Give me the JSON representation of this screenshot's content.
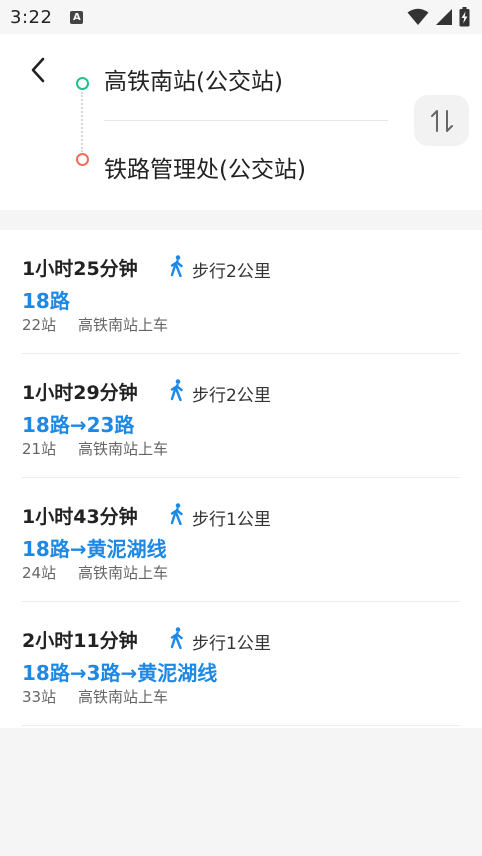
{
  "status_bar": {
    "time": "3:22",
    "notification_glyph": "A",
    "icons": [
      "wifi-icon",
      "signal-icon",
      "battery-charging-icon"
    ]
  },
  "search": {
    "origin": "高铁南站(公交站)",
    "destination": "铁路管理处(公交站)",
    "icons": {
      "back": "back-arrow-icon",
      "swap": "swap-icon"
    },
    "colors": {
      "origin_dot": "#1ec28b",
      "destination_dot": "#f26c5c"
    }
  },
  "accent_color": "#1e88e5",
  "routes": [
    {
      "duration": "1小时25分钟",
      "walk": "步行2公里",
      "lines": "18路",
      "stops": "22站",
      "board": "高铁南站上车"
    },
    {
      "duration": "1小时29分钟",
      "walk": "步行2公里",
      "lines": "18路→23路",
      "stops": "21站",
      "board": "高铁南站上车"
    },
    {
      "duration": "1小时43分钟",
      "walk": "步行1公里",
      "lines": "18路→黄泥湖线",
      "stops": "24站",
      "board": "高铁南站上车"
    },
    {
      "duration": "2小时11分钟",
      "walk": "步行1公里",
      "lines": "18路→3路→黄泥湖线",
      "stops": "33站",
      "board": "高铁南站上车"
    }
  ]
}
